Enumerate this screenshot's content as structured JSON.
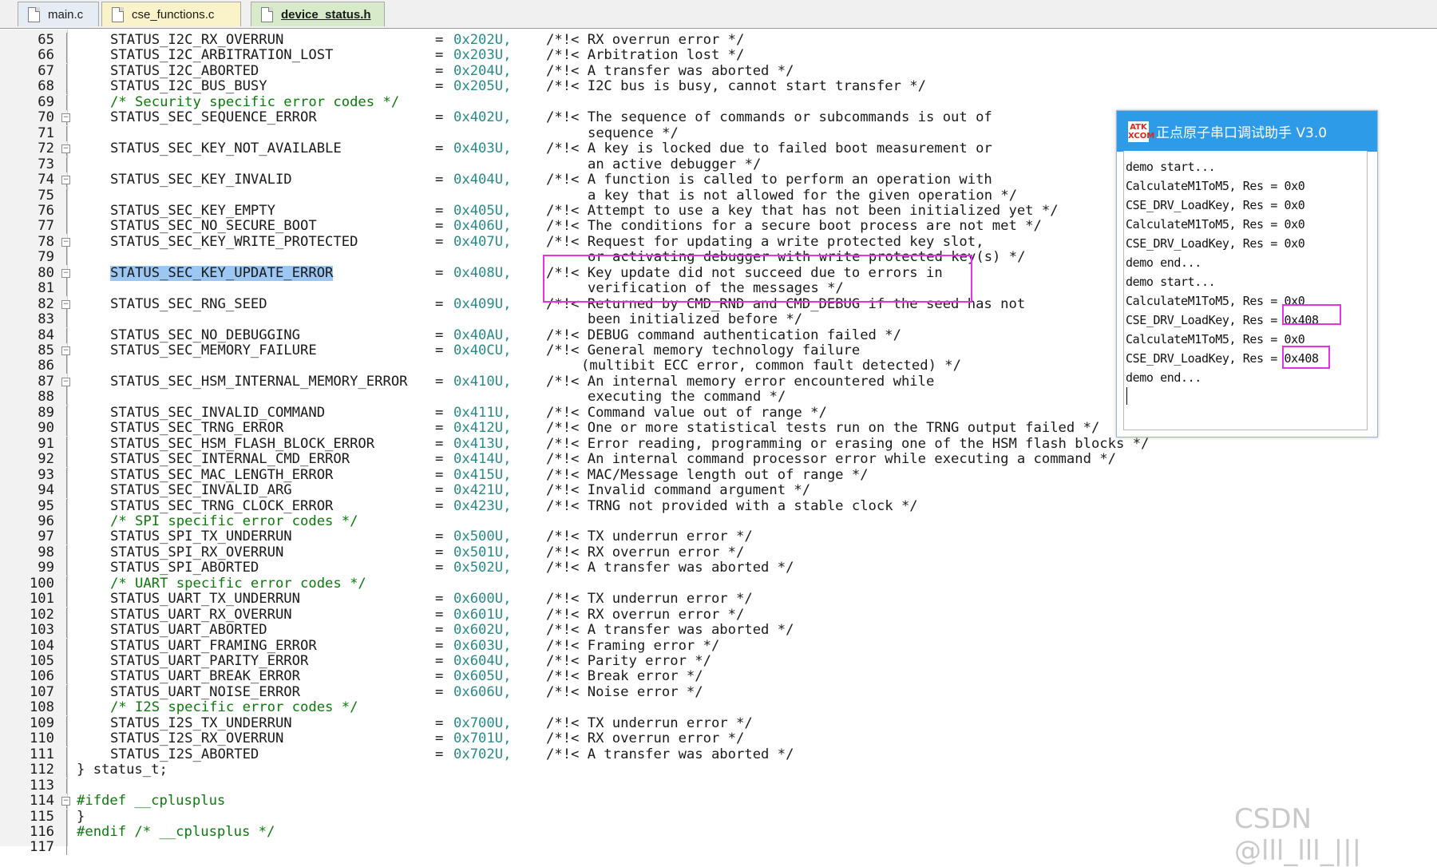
{
  "tabs": [
    {
      "label": "main.c"
    },
    {
      "label": "cse_functions.c"
    },
    {
      "label": "device_status.h"
    }
  ],
  "editor": {
    "lines": [
      {
        "n": "65",
        "kind": "entry",
        "name": "STATUS_I2C_RX_OVERRUN",
        "value": "0x202U,",
        "comment": "/*!< RX overrun error */"
      },
      {
        "n": "66",
        "kind": "entry",
        "name": "STATUS_I2C_ARBITRATION_LOST",
        "value": "0x203U,",
        "comment": "/*!< Arbitration lost */"
      },
      {
        "n": "67",
        "kind": "entry",
        "name": "STATUS_I2C_ABORTED",
        "value": "0x204U,",
        "comment": "/*!< A transfer was aborted */"
      },
      {
        "n": "68",
        "kind": "entry",
        "name": "STATUS_I2C_BUS_BUSY",
        "value": "0x205U,",
        "comment": "/*!< I2C bus is busy, cannot start transfer */"
      },
      {
        "n": "69",
        "kind": "section",
        "text": "/* Security specific error codes */"
      },
      {
        "n": "70",
        "kind": "entry",
        "fold": true,
        "name": "STATUS_SEC_SEQUENCE_ERROR",
        "value": "0x402U,",
        "comment": "/*!< The sequence of commands or subcommands is out of"
      },
      {
        "n": "71",
        "kind": "cont",
        "text": "sequence */"
      },
      {
        "n": "72",
        "kind": "entry",
        "fold": true,
        "name": "STATUS_SEC_KEY_NOT_AVAILABLE",
        "value": "0x403U,",
        "comment": "/*!< A key is locked due to failed boot measurement or"
      },
      {
        "n": "73",
        "kind": "cont",
        "text": "an active debugger */"
      },
      {
        "n": "74",
        "kind": "entry",
        "fold": true,
        "name": "STATUS_SEC_KEY_INVALID",
        "value": "0x404U,",
        "comment": "/*!< A function is called to perform an operation with"
      },
      {
        "n": "75",
        "kind": "cont",
        "text": "a key that is not allowed for the given operation */"
      },
      {
        "n": "76",
        "kind": "entry",
        "name": "STATUS_SEC_KEY_EMPTY",
        "value": "0x405U,",
        "comment": "/*!< Attempt to use a key that has not been initialized yet */"
      },
      {
        "n": "77",
        "kind": "entry",
        "name": "STATUS_SEC_NO_SECURE_BOOT",
        "value": "0x406U,",
        "comment": "/*!< The conditions for a secure boot process are not met */"
      },
      {
        "n": "78",
        "kind": "entry",
        "fold": true,
        "name": "STATUS_SEC_KEY_WRITE_PROTECTED",
        "value": "0x407U,",
        "comment": "/*!< Request for updating a write protected key slot,"
      },
      {
        "n": "79",
        "kind": "cont",
        "text": "or activating debugger with write protected key(s) */"
      },
      {
        "n": "80",
        "kind": "entry",
        "fold": true,
        "highlight": true,
        "name": "STATUS_SEC_KEY_UPDATE_ERROR",
        "value": "0x408U,",
        "comment": "/*!< Key update did not succeed due to errors in"
      },
      {
        "n": "81",
        "kind": "cont",
        "text": "verification of the messages */"
      },
      {
        "n": "82",
        "kind": "entry",
        "fold": true,
        "name": "STATUS_SEC_RNG_SEED",
        "value": "0x409U,",
        "comment": "/*!< Returned by CMD_RND and CMD_DEBUG if the seed has not"
      },
      {
        "n": "83",
        "kind": "cont",
        "text": "been initialized before */"
      },
      {
        "n": "84",
        "kind": "entry",
        "name": "STATUS_SEC_NO_DEBUGGING",
        "value": "0x40AU,",
        "comment": "/*!< DEBUG command authentication failed */"
      },
      {
        "n": "85",
        "kind": "entry",
        "fold": true,
        "name": "STATUS_SEC_MEMORY_FAILURE",
        "value": "0x40CU,",
        "comment": "/*!< General memory technology failure"
      },
      {
        "n": "86",
        "kind": "cont2",
        "text": "(multibit ECC error, common fault detected) */"
      },
      {
        "n": "87",
        "kind": "entry",
        "fold": true,
        "name": "STATUS_SEC_HSM_INTERNAL_MEMORY_ERROR",
        "value": "0x410U,",
        "comment": "/*!< An internal memory error encountered while"
      },
      {
        "n": "88",
        "kind": "cont",
        "text": "executing the command */"
      },
      {
        "n": "89",
        "kind": "entry",
        "name": "STATUS_SEC_INVALID_COMMAND",
        "value": "0x411U,",
        "comment": "/*!< Command value out of range */"
      },
      {
        "n": "90",
        "kind": "entry",
        "name": "STATUS_SEC_TRNG_ERROR",
        "value": "0x412U,",
        "comment": "/*!< One or more statistical tests run on the TRNG output failed */"
      },
      {
        "n": "91",
        "kind": "entry",
        "name": "STATUS_SEC_HSM_FLASH_BLOCK_ERROR",
        "value": "0x413U,",
        "comment": "/*!< Error reading, programming or erasing one of the HSM flash blocks */"
      },
      {
        "n": "92",
        "kind": "entry",
        "name": "STATUS_SEC_INTERNAL_CMD_ERROR",
        "value": "0x414U,",
        "comment": "/*!< An internal command processor error while executing a command */"
      },
      {
        "n": "93",
        "kind": "entry",
        "name": "STATUS_SEC_MAC_LENGTH_ERROR",
        "value": "0x415U,",
        "comment": "/*!< MAC/Message length out of range */"
      },
      {
        "n": "94",
        "kind": "entry",
        "name": "STATUS_SEC_INVALID_ARG",
        "value": "0x421U,",
        "comment": "/*!< Invalid command argument */"
      },
      {
        "n": "95",
        "kind": "entry",
        "name": "STATUS_SEC_TRNG_CLOCK_ERROR",
        "value": "0x423U,",
        "comment": "/*!< TRNG not provided with a stable clock */"
      },
      {
        "n": "96",
        "kind": "section",
        "text": "/* SPI specific error codes */"
      },
      {
        "n": "97",
        "kind": "entry",
        "name": "STATUS_SPI_TX_UNDERRUN",
        "value": "0x500U,",
        "comment": "/*!< TX underrun error */"
      },
      {
        "n": "98",
        "kind": "entry",
        "name": "STATUS_SPI_RX_OVERRUN",
        "value": "0x501U,",
        "comment": "/*!< RX overrun error */"
      },
      {
        "n": "99",
        "kind": "entry",
        "name": "STATUS_SPI_ABORTED",
        "value": "0x502U,",
        "comment": "/*!< A transfer was aborted */"
      },
      {
        "n": "100",
        "kind": "section",
        "text": "/* UART specific error codes */"
      },
      {
        "n": "101",
        "kind": "entry",
        "name": "STATUS_UART_TX_UNDERRUN",
        "value": "0x600U,",
        "comment": "/*!< TX underrun error */"
      },
      {
        "n": "102",
        "kind": "entry",
        "name": "STATUS_UART_RX_OVERRUN",
        "value": "0x601U,",
        "comment": "/*!< RX overrun error */"
      },
      {
        "n": "103",
        "kind": "entry",
        "name": "STATUS_UART_ABORTED",
        "value": "0x602U,",
        "comment": "/*!< A transfer was aborted */"
      },
      {
        "n": "104",
        "kind": "entry",
        "name": "STATUS_UART_FRAMING_ERROR",
        "value": "0x603U,",
        "comment": "/*!< Framing error */"
      },
      {
        "n": "105",
        "kind": "entry",
        "name": "STATUS_UART_PARITY_ERROR",
        "value": "0x604U,",
        "comment": "/*!< Parity error */"
      },
      {
        "n": "106",
        "kind": "entry",
        "name": "STATUS_UART_BREAK_ERROR",
        "value": "0x605U,",
        "comment": "/*!< Break error */"
      },
      {
        "n": "107",
        "kind": "entry",
        "name": "STATUS_UART_NOISE_ERROR",
        "value": "0x606U,",
        "comment": "/*!< Noise error */"
      },
      {
        "n": "108",
        "kind": "section",
        "text": "/* I2S specific error codes */"
      },
      {
        "n": "109",
        "kind": "entry",
        "name": "STATUS_I2S_TX_UNDERRUN",
        "value": "0x700U,",
        "comment": "/*!< TX underrun error */"
      },
      {
        "n": "110",
        "kind": "entry",
        "name": "STATUS_I2S_RX_OVERRUN",
        "value": "0x701U,",
        "comment": "/*!< RX overrun error */"
      },
      {
        "n": "111",
        "kind": "entry",
        "name": "STATUS_I2S_ABORTED",
        "value": "0x702U,",
        "comment": "/*!< A transfer was aborted */"
      },
      {
        "n": "112",
        "kind": "plain",
        "text": "} status_t;"
      },
      {
        "n": "113",
        "kind": "blank"
      },
      {
        "n": "114",
        "kind": "directive",
        "fold": true,
        "text": "#ifdef __cplusplus"
      },
      {
        "n": "115",
        "kind": "plain",
        "text": "}"
      },
      {
        "n": "116",
        "kind": "directive",
        "text": "#endif /* __cplusplus */"
      },
      {
        "n": "117",
        "kind": "blank"
      }
    ]
  },
  "serial_window": {
    "logo_text": "ATK XCOM",
    "title": "正点原子串口调试助手 V3.0",
    "log_lines": [
      "demo start...",
      "CalculateM1ToM5, Res = 0x0",
      "CSE_DRV_LoadKey, Res = 0x0",
      "CalculateM1ToM5, Res = 0x0",
      "CSE_DRV_LoadKey, Res = 0x0",
      "demo end...",
      "demo start...",
      "CalculateM1ToM5, Res = 0x0",
      "CSE_DRV_LoadKey, Res = 0x408",
      "CalculateM1ToM5, Res = 0x0",
      "CSE_DRV_LoadKey, Res = 0x408",
      "demo end..."
    ]
  },
  "watermark": "CSDN @lll_lll_|||",
  "colors": {
    "highlight": "#9cc7f2",
    "annotation_box": "#e632e6",
    "serial_titlebar": "#2e9be8",
    "hex_value": "#2a8a8a",
    "comment_green": "#0b7a0b"
  }
}
